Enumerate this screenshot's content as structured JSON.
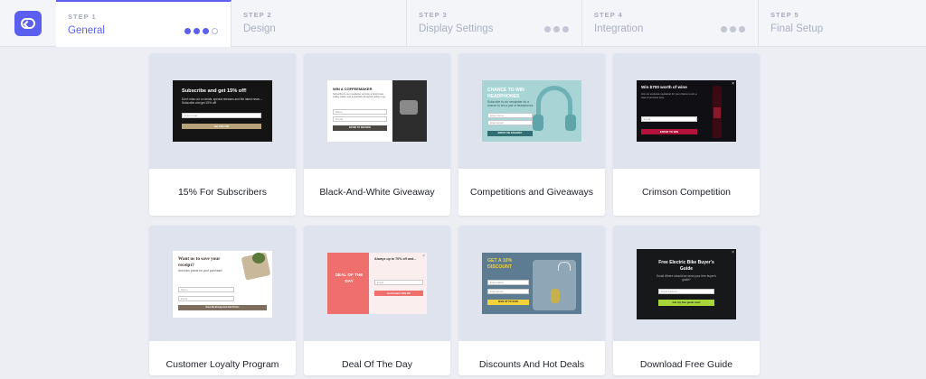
{
  "stepper": {
    "steps": [
      {
        "num": "STEP 1",
        "name": "General"
      },
      {
        "num": "STEP 2",
        "name": "Design"
      },
      {
        "num": "STEP 3",
        "name": "Display Settings"
      },
      {
        "num": "STEP 4",
        "name": "Integration"
      },
      {
        "num": "STEP 5",
        "name": "Final Setup"
      }
    ]
  },
  "templates": [
    {
      "label": "15% For Subscribers",
      "preview": {
        "title": "Subscribe and get 15% off!",
        "text": "Don't miss out on deals, special releases and the latest news – Subscribe and get 15% off!",
        "field": "Enter email",
        "button": "Get 15% Off!"
      }
    },
    {
      "label": "Black-And-White Giveaway",
      "preview": {
        "title": "WIN A COFFEEMAKER",
        "text": "Subscribe to our newsletter and win a brand new coffee maker and a specialty designed coffee mug.",
        "field1": "Name",
        "field2": "E-mail",
        "button": "ENTER TO WIN NOW"
      }
    },
    {
      "label": "Competitions and Giveaways",
      "preview": {
        "title": "CHANCE TO WIN HEADPHONES",
        "text": "Subscribe to our newsletter for a chance to win a pair of headphones.",
        "field1": "Enter Name",
        "field2": "Enter Email",
        "button": "ENTER THE GIVEAWAY"
      }
    },
    {
      "label": "Crimson Competition",
      "preview": {
        "title": "Win $700 worth of wine",
        "text": "Join our exclusive newsletter for your chance to win a case of premium wine.",
        "field": "Email",
        "button": "ENTER TO WIN"
      }
    },
    {
      "label": "Customer Loyalty Program",
      "preview": {
        "title": "Want us to save your receipt?",
        "text": "And earn points for your purchase!",
        "field1": "Name",
        "field2": "Email",
        "button": "Save My Receipt and Add Points"
      }
    },
    {
      "label": "Deal Of The Day",
      "preview": {
        "badge": "DEAL OF THE DAY",
        "title": "Always up to 70% off and...",
        "field": "Email",
        "button": "Get Instant 10% Off"
      }
    },
    {
      "label": "Discounts And Hot Deals",
      "preview": {
        "title": "GET A 10% DISCOUNT",
        "field1": "Enter Name",
        "field2": "Enter Email",
        "button": "SIGN UP TO SAVE"
      }
    },
    {
      "label": "Download Free Guide",
      "preview": {
        "title": "Free Electric Bike Buyer's Guide",
        "text": "Email Where should we send your free buyer's guide?",
        "field": "Email Address",
        "button": "Get my free guide now!"
      }
    }
  ],
  "colors": {
    "accent": "#5b5ff0",
    "background": "#eceef4",
    "thumb_bg": "#dfe3ee"
  }
}
